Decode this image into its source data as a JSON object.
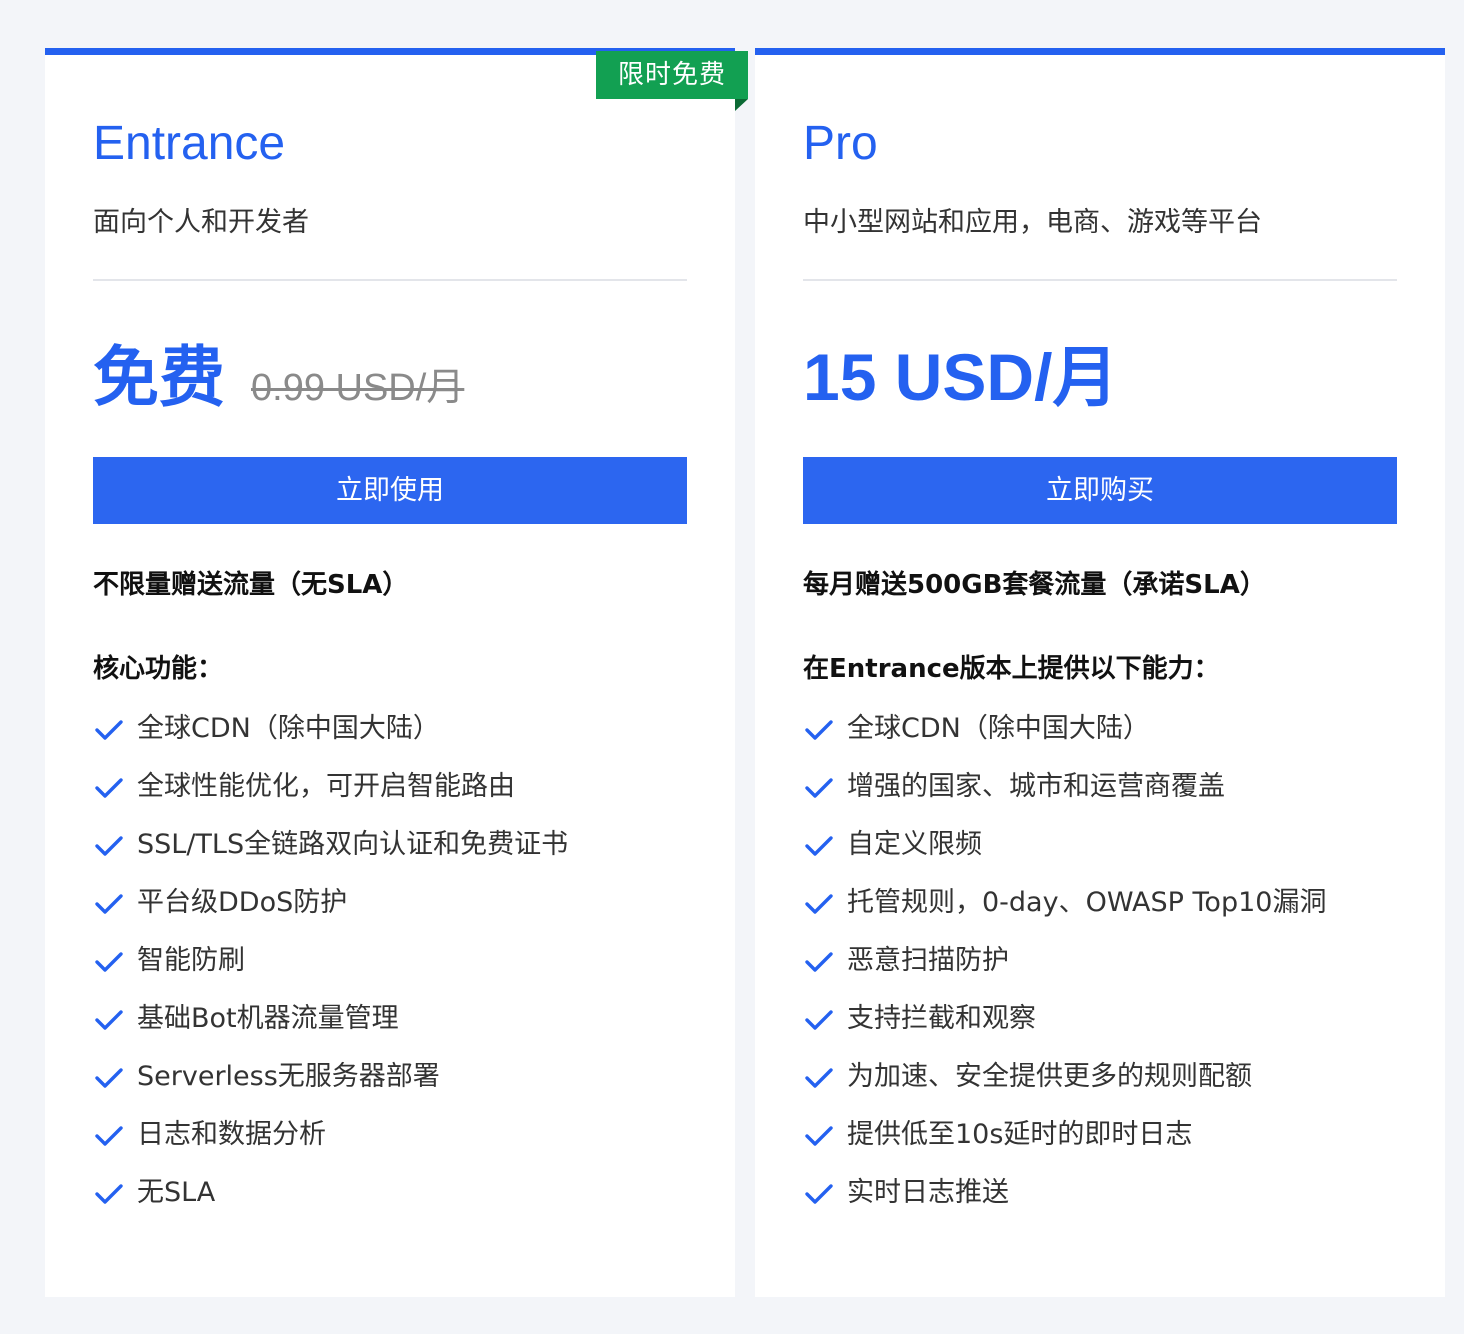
{
  "plans": [
    {
      "title": "Entrance",
      "badge": "限时免费",
      "description": "面向个人和开发者",
      "price": "免费",
      "original_price": "0.99 USD/月",
      "cta_label": "立即使用",
      "quota": "不限量赠送流量（无SLA）",
      "features_heading": "核心功能：",
      "features": [
        "全球CDN（除中国大陆）",
        "全球性能优化，可开启智能路由",
        "SSL/TLS全链路双向认证和免费证书",
        "平台级DDoS防护",
        "智能防刷",
        "基础Bot机器流量管理",
        "Serverless无服务器部署",
        "日志和数据分析",
        "无SLA"
      ]
    },
    {
      "title": "Pro",
      "description": "中小型网站和应用，电商、游戏等平台",
      "price": "15 USD/月",
      "cta_label": "立即购买",
      "quota": "每月赠送500GB套餐流量（承诺SLA）",
      "features_heading": "在Entrance版本上提供以下能力：",
      "features": [
        "全球CDN（除中国大陆）",
        "增强的国家、城市和运营商覆盖",
        "自定义限频",
        "托管规则，0-day、OWASP Top10漏洞",
        "恶意扫描防护",
        "支持拦截和观察",
        "为加速、安全提供更多的规则配额",
        "提供低至10s延时的即时日志",
        "实时日志推送"
      ]
    }
  ],
  "colors": {
    "accent": "#2461f0",
    "button": "#2c66f0",
    "badge": "#12a052",
    "background": "#f3f5f9"
  },
  "icons": {
    "feature_bullet": "check-icon"
  }
}
